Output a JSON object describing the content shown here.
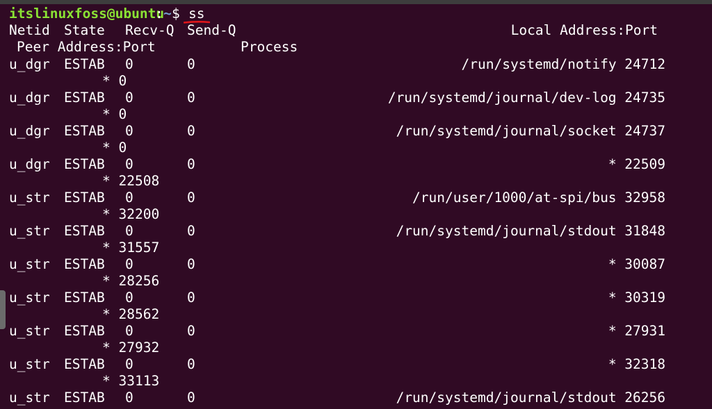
{
  "prompt": {
    "user_host": "itslinuxfoss@ubuntu",
    "separator": ":",
    "path": "~",
    "symbol": "$",
    "command": "ss"
  },
  "header": {
    "netid": "Netid",
    "state": "State",
    "recvq": "Recv-Q",
    "sendq": "Send-Q",
    "local": "Local Address:Port",
    "peer": "Peer Address:Port",
    "process": "Process"
  },
  "rows": [
    {
      "netid": "u_dgr",
      "state": "ESTAB",
      "recvq": "0",
      "sendq": "0",
      "local": "/run/systemd/notify 24712",
      "peer": "* 0"
    },
    {
      "netid": "u_dgr",
      "state": "ESTAB",
      "recvq": "0",
      "sendq": "0",
      "local": "/run/systemd/journal/dev-log 24735",
      "peer": "* 0"
    },
    {
      "netid": "u_dgr",
      "state": "ESTAB",
      "recvq": "0",
      "sendq": "0",
      "local": "/run/systemd/journal/socket 24737",
      "peer": "* 0"
    },
    {
      "netid": "u_dgr",
      "state": "ESTAB",
      "recvq": "0",
      "sendq": "0",
      "local": "* 22509",
      "peer": "* 22508"
    },
    {
      "netid": "u_str",
      "state": "ESTAB",
      "recvq": "0",
      "sendq": "0",
      "local": "/run/user/1000/at-spi/bus 32958",
      "peer": "* 32200"
    },
    {
      "netid": "u_str",
      "state": "ESTAB",
      "recvq": "0",
      "sendq": "0",
      "local": "/run/systemd/journal/stdout 31848",
      "peer": "* 31557"
    },
    {
      "netid": "u_str",
      "state": "ESTAB",
      "recvq": "0",
      "sendq": "0",
      "local": "* 30087",
      "peer": "* 28256"
    },
    {
      "netid": "u_str",
      "state": "ESTAB",
      "recvq": "0",
      "sendq": "0",
      "local": "* 30319",
      "peer": "* 28562"
    },
    {
      "netid": "u_str",
      "state": "ESTAB",
      "recvq": "0",
      "sendq": "0",
      "local": "* 27931",
      "peer": "* 27932"
    },
    {
      "netid": "u_str",
      "state": "ESTAB",
      "recvq": "0",
      "sendq": "0",
      "local": "* 32318",
      "peer": "* 33113"
    },
    {
      "netid": "u_str",
      "state": "ESTAB",
      "recvq": "0",
      "sendq": "0",
      "local": "/run/systemd/journal/stdout 26256",
      "peer": ""
    }
  ],
  "colors": {
    "background": "#300a24",
    "text": "#ffffff",
    "user_host": "#8ae234",
    "path": "#729fcf",
    "annotation": "#e0161b"
  },
  "annotation": "red-underline-mark"
}
